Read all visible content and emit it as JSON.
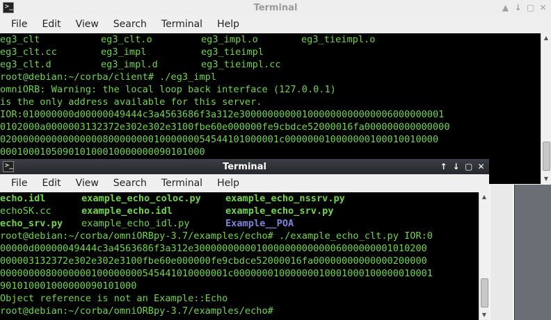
{
  "colors": {
    "terminal_bg": "#000000",
    "terminal_fg": "#6fd64a",
    "directory_blue": "#7b86d8"
  },
  "window_back": {
    "title": "Terminal",
    "icon": "terminal-icon",
    "controls": [
      "▲",
      "↓",
      "▢",
      "✕"
    ],
    "menu": [
      "File",
      "Edit",
      "View",
      "Search",
      "Terminal",
      "Help"
    ],
    "ls": [
      [
        "eg3_clt",
        "eg3_clt.o",
        "eg3_impl.o",
        "eg3_tieimpl.o"
      ],
      [
        "eg3_clt.cc",
        "eg3_impl",
        "eg3_tieimpl",
        ""
      ],
      [
        "eg3_clt.d",
        "eg3_impl.d",
        "eg3_tieimpl.cc",
        ""
      ]
    ],
    "lines": [
      "root@debian:~/corba/client# ./eg3_impl",
      "omniORB: Warning: the local loop back interface (127.0.0.1)",
      "is the only address available for this server.",
      "IOR:010000000d00000049444c3a4563686f3a312e300000000001000000000000006000000001",
      "0102000a0000003132372e302e302e3100fbe60e000000fe9cbdce52000016fa000000000000000",
      "0200000000000000008000000001000000054544101000001c000000010000000100010010000",
      "000100010509010100010000000090101000"
    ]
  },
  "window_front": {
    "title": "Terminal",
    "icon": "terminal-icon",
    "controls": [
      "↑",
      "↓",
      "▢",
      "✕"
    ],
    "menu": [
      "File",
      "Edit",
      "View",
      "Search",
      "Terminal",
      "Help"
    ],
    "ls": [
      [
        "echo.idl",
        "example_echo_coloc.py",
        "example_echo_nssrv.py"
      ],
      [
        "echoSK.cc",
        "example_echo.idl",
        "example_echo_srv.py"
      ],
      [
        "echo_srv.py",
        "example_echo_idl.py",
        "Example__POA"
      ]
    ],
    "lines": [
      "root@debian:~/corba/omniORBpy-3.7/examples/echo# ./example_echo_clt.py IOR:0",
      "00000d00000049444c3a4563686f3a312e30000000000100000000000006000000001010200",
      "000003132372e302e302e3100fbe60e000000fe9cbdce52000016fa00000000000000200000",
      "0000000080000000100000000545441010000001c00000001000000010001000100000010001",
      "901010001000000090101000",
      "Object reference is not an Example::Echo",
      "root@debian:~/corba/omniORBpy-3.7/examples/echo# "
    ]
  }
}
